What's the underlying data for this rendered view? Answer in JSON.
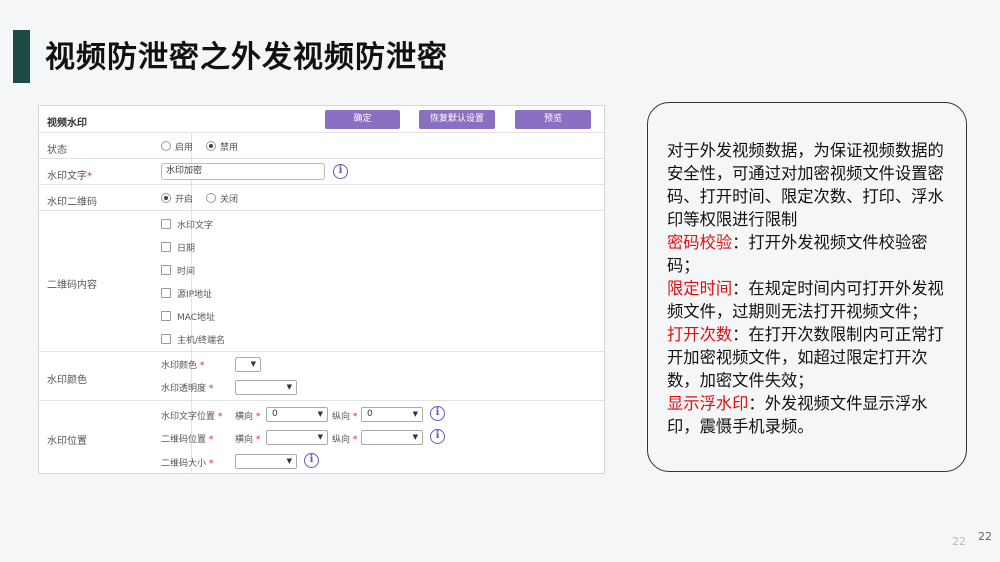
{
  "slide": {
    "title": "视频防泄密之外发视频防泄密",
    "page_number_faded": "22",
    "page_number": "22"
  },
  "panel": {
    "title": "视频水印",
    "buttons": {
      "confirm": "确定",
      "reset": "恢复默认设置",
      "preview": "预览"
    },
    "status": {
      "label": "状态",
      "opt_enable": "启用",
      "opt_disable": "禁用",
      "selected": "禁用"
    },
    "watermark_text": {
      "label": "水印文字",
      "required_mark": "*",
      "value": "水印加密"
    },
    "qr": {
      "label": "水印二维码",
      "opt_on": "开启",
      "opt_off": "关闭",
      "selected": "开启"
    },
    "qr_content": {
      "label": "二维码内容",
      "items": [
        "水印文字",
        "日期",
        "时间",
        "源IP地址",
        "MAC地址",
        "主机/终端名"
      ]
    },
    "color": {
      "label": "水印颜色",
      "color_label": "水印颜色",
      "alpha_label": "水印透明度",
      "required_mark": "*"
    },
    "position": {
      "label": "水印位置",
      "text_pos_label": "水印文字位置",
      "qr_pos_label": "二维码位置",
      "qr_size_label": "二维码大小",
      "h_label": "横向",
      "v_label": "纵向",
      "required_mark": "*",
      "text_pos_h": "0",
      "text_pos_v": "0",
      "arrow": "▼"
    },
    "info_glyph": "i"
  },
  "note": {
    "intro": "对于外发视频数据，为保证视频数据的安全性，可通过对加密视频文件设置密码、打开时间、限定次数、打印、浮水印等权限进行限制",
    "items": [
      {
        "key": "密码校验",
        "text": "：打开外发视频文件校验密码；"
      },
      {
        "key": "限定时间",
        "text": "：在规定时间内可打开外发视频文件，过期则无法打开视频文件；"
      },
      {
        "key": "打开次数",
        "text": "：在打开次数限制内可正常打开加密视频文件，如超过限定打开次数，加密文件失效；"
      },
      {
        "key": "显示浮水印",
        "text": "：外发视频文件显示浮水印，震慑手机录频。"
      }
    ]
  },
  "colors": {
    "accent": "#8b6fc2",
    "title_bar": "#1d4a44",
    "highlight": "#e01010"
  }
}
